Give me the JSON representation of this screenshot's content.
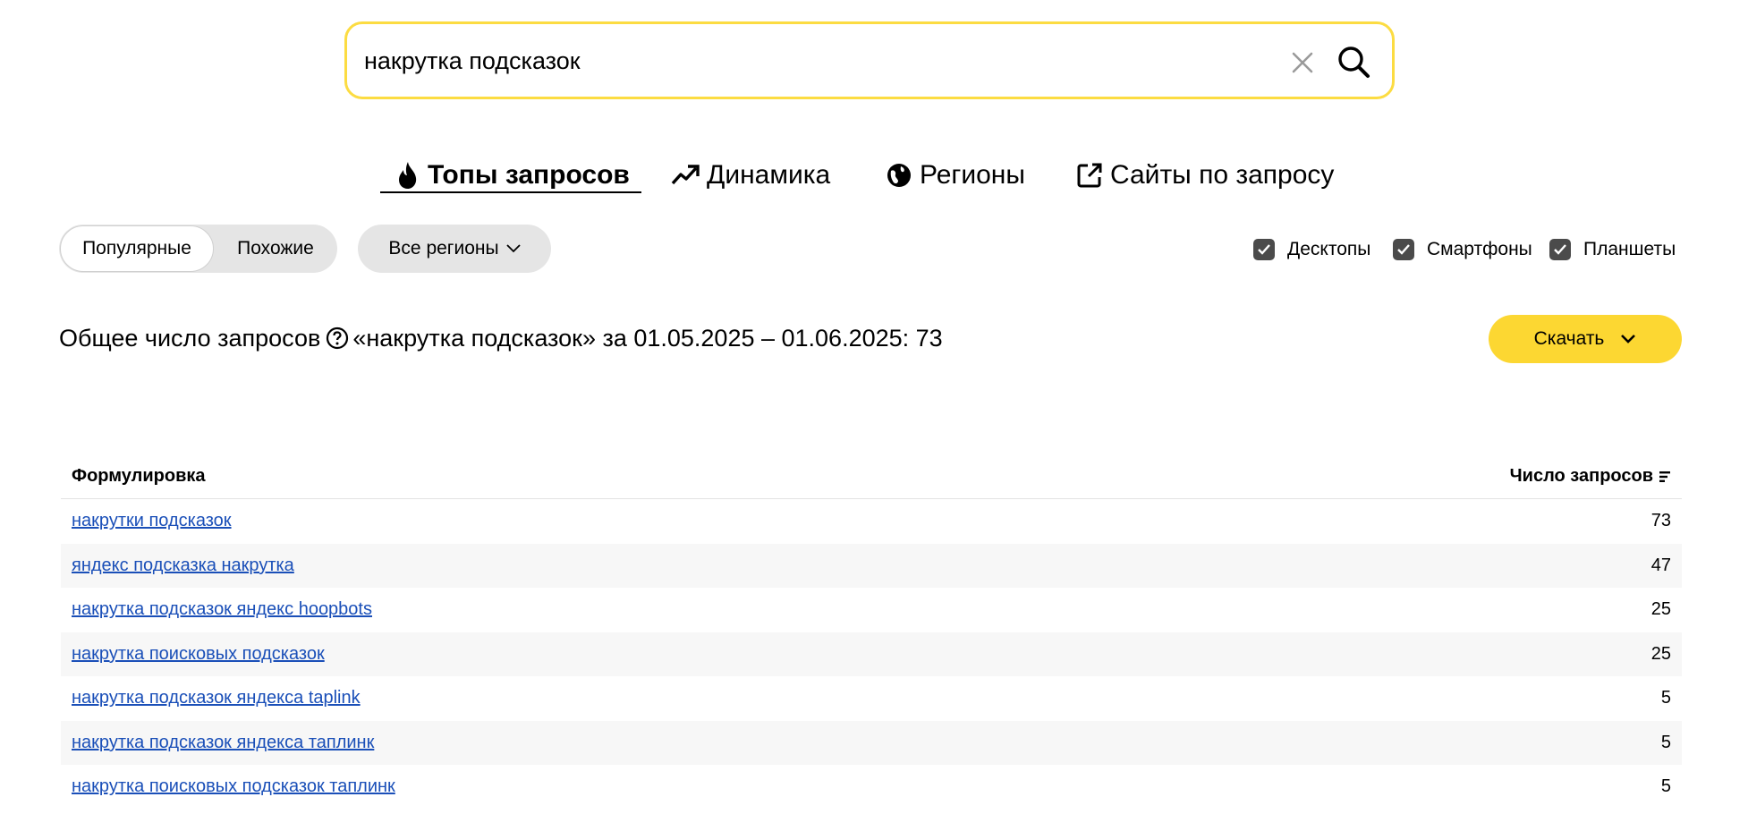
{
  "search": {
    "value": "накрутка подсказок"
  },
  "tabs": [
    {
      "label": "Топы запросов",
      "active": true
    },
    {
      "label": "Динамика",
      "active": false
    },
    {
      "label": "Регионы",
      "active": false
    },
    {
      "label": "Сайты по запросу",
      "active": false
    }
  ],
  "filters": {
    "popular": "Популярные",
    "similar": "Похожие",
    "regions": "Все регионы"
  },
  "devices": [
    {
      "label": "Десктопы",
      "checked": true
    },
    {
      "label": "Смартфоны",
      "checked": true
    },
    {
      "label": "Планшеты",
      "checked": true
    }
  ],
  "summary": {
    "prefix": "Общее число запросов",
    "suffix": "«накрутка подсказок» за 01.05.2025 – 01.06.2025: 73"
  },
  "download_label": "Скачать",
  "table": {
    "col_phrase": "Формулировка",
    "col_count": "Число запросов",
    "rows": [
      {
        "phrase": "накрутки подсказок",
        "count": "73"
      },
      {
        "phrase": "яндекс подсказка накрутка",
        "count": "47"
      },
      {
        "phrase": "накрутка подсказок яндекс hoopbots",
        "count": "25"
      },
      {
        "phrase": "накрутка поисковых подсказок",
        "count": "25"
      },
      {
        "phrase": "накрутка подсказок яндекса taplink",
        "count": "5"
      },
      {
        "phrase": "накрутка подсказок яндекса таплинк",
        "count": "5"
      },
      {
        "phrase": "накрутка поисковых подсказок таплинк",
        "count": "5"
      }
    ]
  },
  "colors": {
    "accent": "#fcd732",
    "link": "#1a4fb8"
  }
}
